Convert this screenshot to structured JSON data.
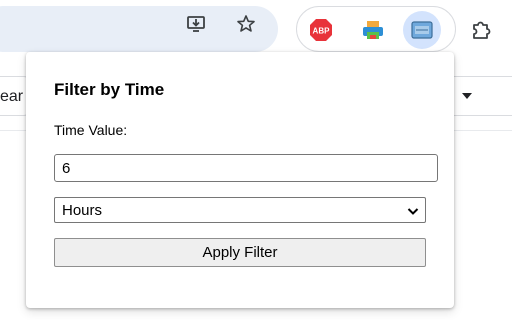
{
  "popup": {
    "title": "Filter by Time",
    "time_value_label": "Time Value:",
    "time_value_input": "6",
    "unit_select_value": "Hours",
    "apply_button_label": "Apply Filter"
  },
  "page_background": {
    "search_input_partial_text": "ear"
  },
  "toolbar": {
    "icons": [
      "install-app-icon",
      "bookmark-star-icon"
    ],
    "extensions": [
      "adblock-plus-icon",
      "printer-extension-icon",
      "time-filter-extension-icon",
      "extensions-puzzle-icon"
    ],
    "adblock_badge_text": "ABP",
    "colors": {
      "omnibox_bg": "#e8eef7",
      "active_extension_bg": "#d3e3fd",
      "adblock_red": "#e8333a"
    }
  }
}
